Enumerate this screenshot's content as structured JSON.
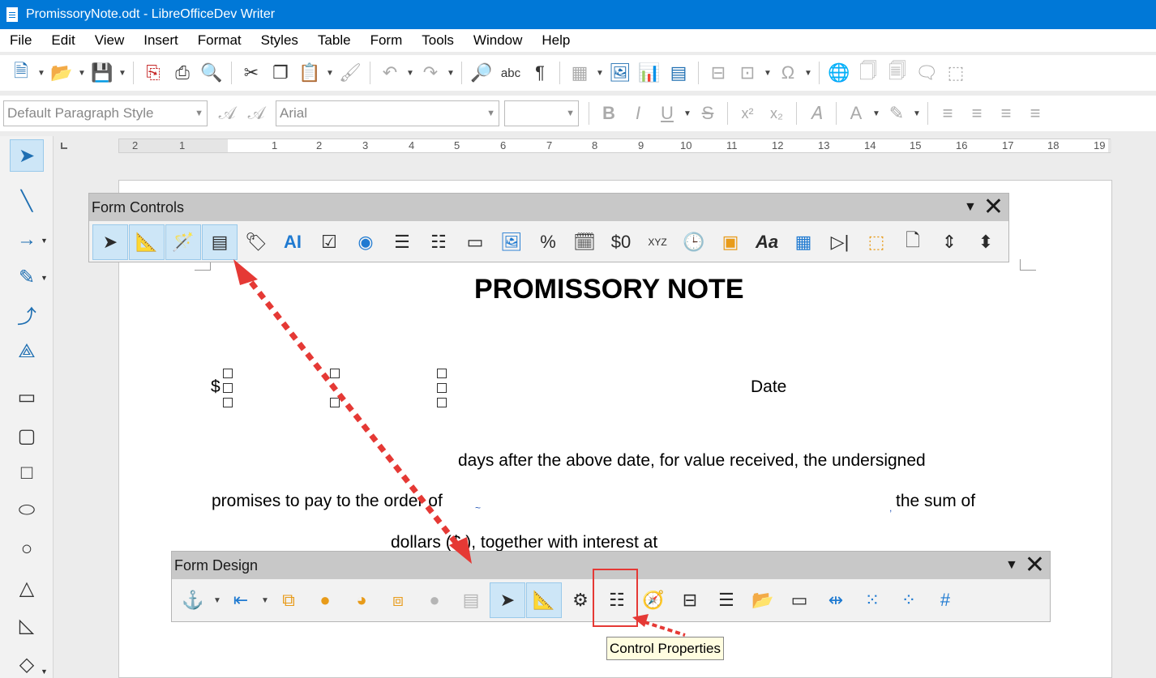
{
  "window": {
    "title": "PromissoryNote.odt - LibreOfficeDev Writer"
  },
  "menu": [
    "File",
    "Edit",
    "View",
    "Insert",
    "Format",
    "Styles",
    "Table",
    "Form",
    "Tools",
    "Window",
    "Help"
  ],
  "formatting": {
    "paragraph_style": "Default Paragraph Style",
    "font_name": "Arial",
    "font_size": ""
  },
  "ruler": {
    "numbers": [
      "2",
      "1",
      "1",
      "2",
      "3",
      "4",
      "5",
      "6",
      "7",
      "8",
      "9",
      "10",
      "11",
      "12",
      "13",
      "14",
      "15",
      "16",
      "17",
      "18",
      "19"
    ]
  },
  "form_controls_toolbar": {
    "title": "Form Controls"
  },
  "form_design_toolbar": {
    "title": "Form Design"
  },
  "document": {
    "title": "PROMISSORY NOTE",
    "dollar_sign": "$",
    "date_label": "Date",
    "line1": "days after the above date, for value received, the undersigned",
    "line2_start": "promises to pay to the order of",
    "line2_end": "the sum of",
    "line3": "dollars ($                          ), together with interest at"
  },
  "tooltip": {
    "text": "Control Properties"
  },
  "colors": {
    "titlebar": "#0078d7",
    "annotation": "#e53935",
    "active_button": "#cde6f7"
  },
  "icons": {
    "form_controls": [
      "select-icon",
      "design-mode-icon",
      "control-wizards-icon",
      "form-design-icon",
      "label-icon",
      "text-box-icon",
      "check-box-icon",
      "option-button-icon",
      "list-box-icon",
      "combo-box-icon",
      "push-button-icon",
      "image-button-icon",
      "formatted-field-icon",
      "date-field-icon",
      "currency-field-icon",
      "pattern-field-icon",
      "time-field-icon",
      "image-control-icon",
      "font-icon",
      "table-control-icon",
      "navigation-bar-icon",
      "group-box-icon",
      "file-selection-icon",
      "spin-button-icon",
      "scrollbar-icon"
    ],
    "form_design": [
      "anchor-icon",
      "align-icon",
      "bring-to-front-icon",
      "send-to-back-icon",
      "forward-icon",
      "backward-icon",
      "group-icon",
      "ungroup-icon",
      "select-icon",
      "design-mode-icon",
      "control-properties-icon",
      "form-properties-icon",
      "form-navigator-icon",
      "add-field-icon",
      "activation-order-icon",
      "open-in-design-mode-icon",
      "automatic-control-focus-icon",
      "position-and-size-icon",
      "display-grid-icon",
      "snap-to-grid-icon",
      "helplines-icon"
    ]
  }
}
